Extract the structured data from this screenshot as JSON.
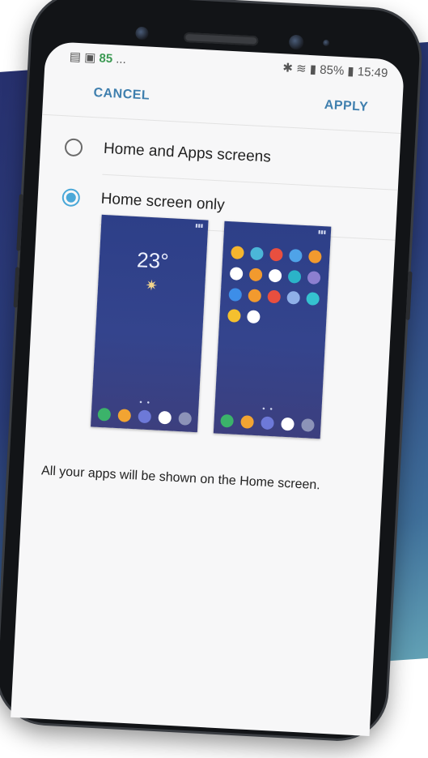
{
  "status_bar": {
    "left_icons": [
      "notification-icon",
      "image-icon"
    ],
    "left_badge": "85",
    "left_more": "...",
    "right_icons": [
      "bluetooth-icon",
      "wifi-icon",
      "signal-icon",
      "battery-icon"
    ],
    "battery": "85%",
    "time": "15:49"
  },
  "action_bar": {
    "cancel_label": "CANCEL",
    "apply_label": "APPLY"
  },
  "options": [
    {
      "label": "Home and Apps screens",
      "selected": false
    },
    {
      "label": "Home screen only",
      "selected": true
    }
  ],
  "preview_home": {
    "temperature": "23°",
    "weather_icon": "sun-icon",
    "dock_colors": [
      "#3bb36a",
      "#f2a432",
      "#6d79d8",
      "#ffffff",
      "#8c93b8"
    ]
  },
  "preview_apps": {
    "grid_colors": [
      "#f5b52e",
      "#4bb6d8",
      "#e94f3f",
      "#4fa3e8",
      "#f29a2e",
      "#ffffff",
      "#f29a2e",
      "#ffffff",
      "#2bb3c8",
      "#8c7fd0",
      "#3d8ee8",
      "#f29a2e",
      "#e94f3f",
      "#8fb0e8",
      "#35c2d0",
      "#f5c02e",
      "#ffffff"
    ],
    "dock_colors": [
      "#3bb36a",
      "#f2a432",
      "#6d79d8",
      "#ffffff",
      "#8c93b8"
    ]
  },
  "description": "All your apps will be shown on the Home screen.",
  "colors": {
    "accent": "#3f7fae",
    "radio_on": "#4aa8d8",
    "background_gradient_start": "#27306e",
    "background_gradient_end": "#66a7b8"
  }
}
